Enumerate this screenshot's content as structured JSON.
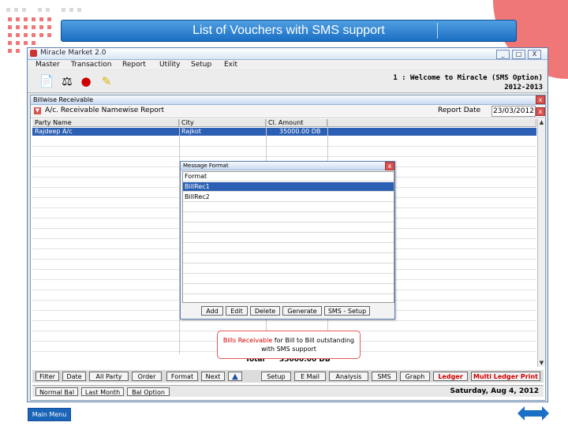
{
  "slide": {
    "title": "List of Vouchers with SMS support",
    "main_menu_label": "Main Menu",
    "accent_color": "#1b6fc4",
    "corner_color": "#ef7777"
  },
  "window": {
    "title": "Miracle Market 2.0",
    "controls": [
      "_",
      "□",
      "X"
    ],
    "menu": [
      "Master",
      "Transaction",
      "Report",
      "Utility",
      "Setup",
      "Exit"
    ],
    "toolbar_icons": [
      "new-document-icon",
      "scale-icon",
      "money-bag-icon",
      "notes-icon"
    ],
    "welcome_line1": "1 : Welcome to Miracle (SMS Option)",
    "welcome_line2": "2012-2013"
  },
  "report_window": {
    "title": "Billwise Receivable",
    "report_title": "A/c. Receivable Namewise Report",
    "report_date_label": "Report Date",
    "report_date": "23/03/2012",
    "columns": [
      "Party Name",
      "City",
      "Cl. Amount"
    ],
    "rows": [
      {
        "party": "Rajdeep A/c",
        "city": "Rajkot",
        "amount": "35000.00 DB"
      }
    ],
    "total_label": "Total",
    "total_value": "35000.00 DB"
  },
  "message_dialog": {
    "title": "Message Format",
    "header": "Format",
    "items": [
      "BillRec1",
      "BillRec2"
    ],
    "selected_index": 0,
    "buttons": [
      "Add",
      "Edit",
      "Delete",
      "Generate",
      "SMS - Setup"
    ]
  },
  "callout": {
    "highlight": "Bills Receivable",
    "line1_rest": " for Bill to Bill outstanding",
    "line2": "with SMS support"
  },
  "button_bar": [
    {
      "label": "Filter",
      "red": false
    },
    {
      "label": "Date",
      "red": false
    },
    {
      "label": "All Party",
      "red": false
    },
    {
      "label": "Order",
      "red": false
    },
    {
      "label": "Format",
      "red": false
    },
    {
      "label": "Next",
      "red": false
    },
    {
      "label": "Setup",
      "red": false
    },
    {
      "label": "E Mail",
      "red": false
    },
    {
      "label": "Analysis",
      "red": false
    },
    {
      "label": "SMS",
      "red": false
    },
    {
      "label": "Graph",
      "red": false
    },
    {
      "label": "Ledger",
      "red": true
    },
    {
      "label": "Multi Ledger Print",
      "red": true
    }
  ],
  "status_bar": {
    "buttons": [
      "Normal Bal",
      "Last Month",
      "Bal Option"
    ],
    "date": "Saturday, Aug 4, 2012"
  }
}
